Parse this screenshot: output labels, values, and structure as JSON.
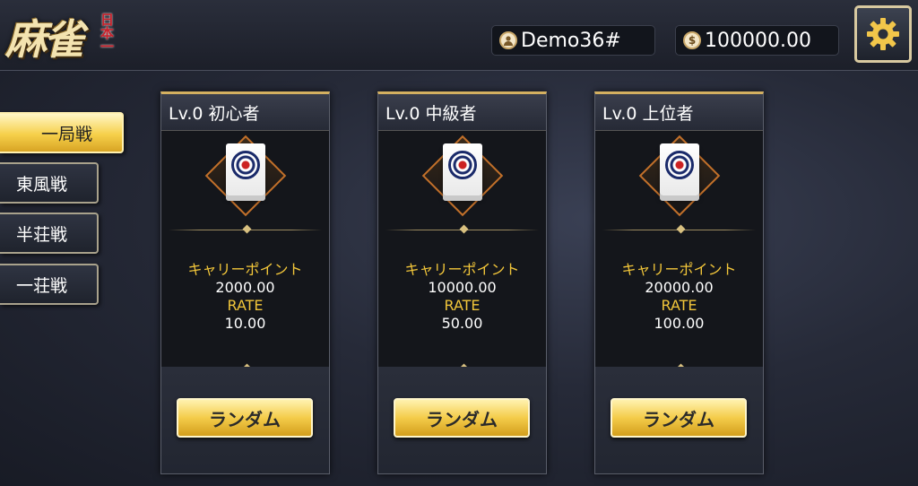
{
  "header": {
    "logo_text": "麻雀",
    "logo_sub": "日本一",
    "username": "Demo36#",
    "balance": "100000.00"
  },
  "sidebar": {
    "items": [
      {
        "label": "一局戦",
        "active": true
      },
      {
        "label": "東風戦",
        "active": false
      },
      {
        "label": "半荘戦",
        "active": false
      },
      {
        "label": "一荘戦",
        "active": false
      }
    ]
  },
  "rooms": [
    {
      "title": "Lv.0 初心者",
      "carry_label": "キャリーポイント",
      "carry_value": "2000.00",
      "rate_label": "RATE",
      "rate_value": "10.00",
      "button": "ランダム"
    },
    {
      "title": "Lv.0 中級者",
      "carry_label": "キャリーポイント",
      "carry_value": "10000.00",
      "rate_label": "RATE",
      "rate_value": "50.00",
      "button": "ランダム"
    },
    {
      "title": "Lv.0 上位者",
      "carry_label": "キャリーポイント",
      "carry_value": "20000.00",
      "rate_label": "RATE",
      "rate_value": "100.00",
      "button": "ランダム"
    }
  ],
  "colors": {
    "accent_gold": "#f2c63a",
    "button_gold": "#f4cc4a"
  }
}
